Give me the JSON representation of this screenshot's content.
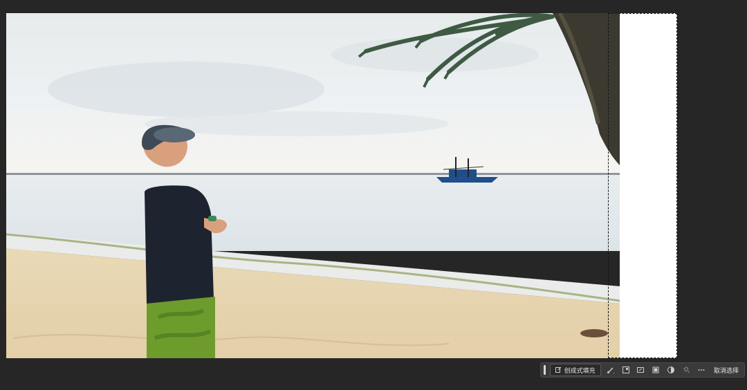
{
  "canvas": {
    "scene": "beach-photo",
    "extended_area_color": "#ffffff"
  },
  "task_bar": {
    "generative_fill_label": "创成式填充",
    "deselect_label": "取消选择",
    "icons": [
      "generative-fill-icon",
      "brush-mask-icon",
      "transform-selection-icon",
      "expand-selection-icon",
      "mask-icon",
      "adjustment-icon",
      "fill-selection-icon",
      "more-options-icon"
    ]
  },
  "colors": {
    "workspace_bg": "#262626",
    "taskbar_bg": "#3a3a3a",
    "taskbar_text": "#e6e6e6"
  }
}
